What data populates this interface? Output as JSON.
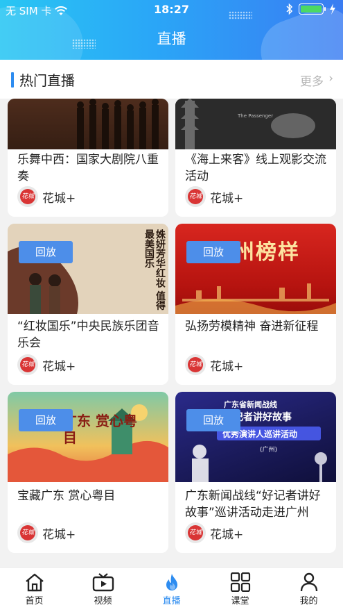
{
  "status_bar": {
    "carrier": "无 SIM 卡",
    "time": "18:27"
  },
  "header": {
    "title": "直播"
  },
  "section": {
    "title": "热门直播",
    "more": "更多"
  },
  "cards": [
    {
      "title": "乐舞中西：国家大剧院八重奏",
      "source": "花城+",
      "replay": ""
    },
    {
      "title": "《海上来客》线上观影交流活动",
      "source": "花城+",
      "replay": ""
    },
    {
      "title": "“红妆国乐”中央民族乐团音乐会",
      "source": "花城+",
      "replay": "回放"
    },
    {
      "title": "弘扬劳模精神 奋进新征程",
      "source": "花城+",
      "replay": "回放"
    },
    {
      "title": "宝藏广东 赏心粤目",
      "source": "花城+",
      "replay": "回放"
    },
    {
      "title": "广东新闻战线“好记者讲好故事”巡讲活动走进广州",
      "source": "花城+",
      "replay": "回放"
    }
  ],
  "thumb_text": {
    "card3": "姝妍芳华红妆 值得最美国乐",
    "card4": "广州榜样",
    "card5": "广东 赏心粤目",
    "card6a": "广东省新闻战线",
    "card6b": "好记者讲好故事",
    "card6c": "优秀演讲人巡讲活动",
    "card6d": "(广州)"
  },
  "logo_text": "花城",
  "tabbar": [
    {
      "label": "首页",
      "icon": "home-icon"
    },
    {
      "label": "视频",
      "icon": "video-icon"
    },
    {
      "label": "直播",
      "icon": "live-flame-icon"
    },
    {
      "label": "课堂",
      "icon": "grid-icon"
    },
    {
      "label": "我的",
      "icon": "user-icon"
    }
  ],
  "colors": {
    "accent": "#2d8cf0",
    "header_start": "#29c6f3",
    "header_end": "#3a7cf2",
    "badge": "#4d8ee9",
    "battery": "#4cd964"
  }
}
